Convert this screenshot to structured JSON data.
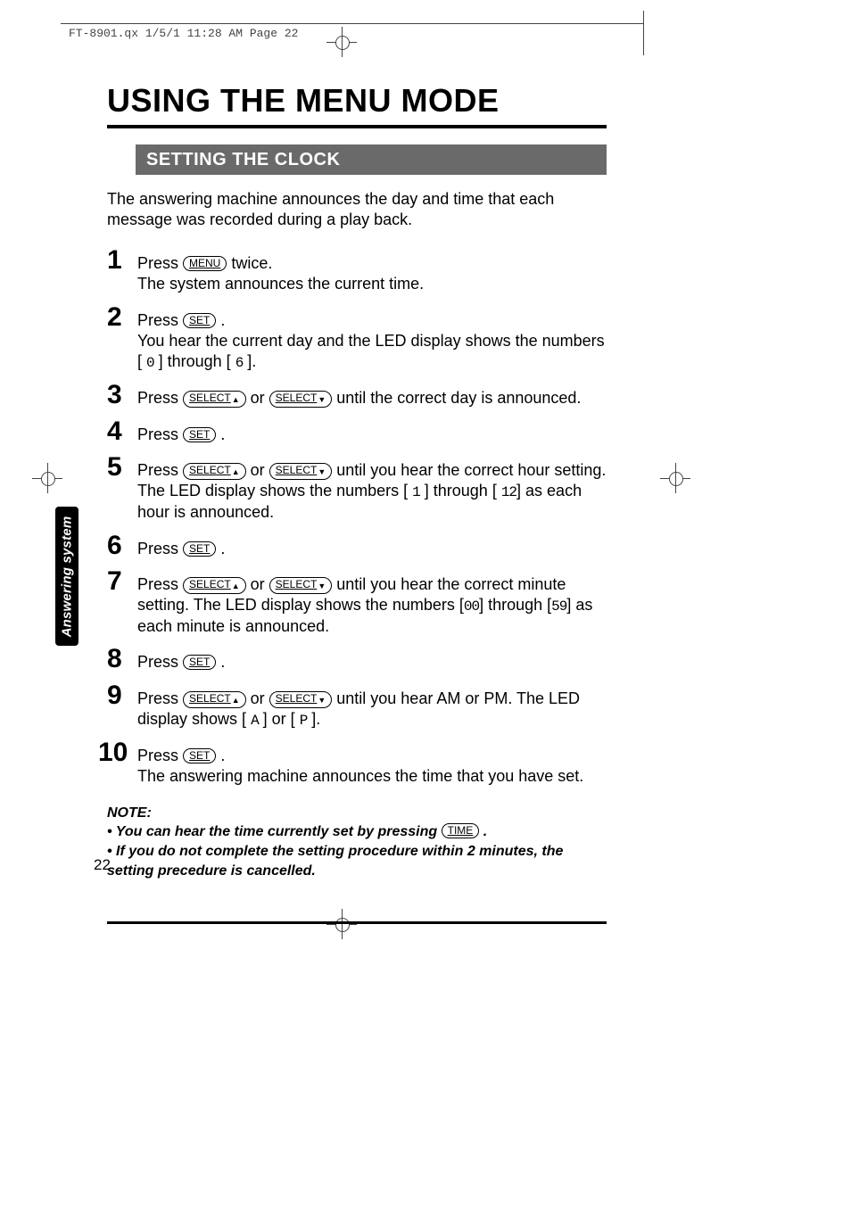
{
  "slug": "FT-8901.qx  1/5/1 11:28 AM  Page 22",
  "title": "USING THE MENU MODE",
  "section": "SETTING THE CLOCK",
  "intro": "The answering machine announces the day and time that each message was recorded during a play back.",
  "buttons": {
    "menu": "MENU",
    "set": "SET",
    "select_up": "SELECT",
    "select_down": "SELECT",
    "time": "TIME"
  },
  "steps": {
    "s1": {
      "n": "1",
      "a": "Press ",
      "b": " twice.",
      "c": "The system announces the current time."
    },
    "s2": {
      "n": "2",
      "a": "Press ",
      "b": " .",
      "c1": "You hear the current day and the LED display shows the numbers [ ",
      "seg1": "0",
      "c2": " ] through [ ",
      "seg2": "6",
      "c3": " ]."
    },
    "s3": {
      "n": "3",
      "a": "Press ",
      "b": " or ",
      "c": " until the correct day is announced."
    },
    "s4": {
      "n": "4",
      "a": "Press ",
      "b": " ."
    },
    "s5": {
      "n": "5",
      "a": "Press ",
      "b": " or ",
      "c": " until you hear the correct hour setting. The LED display shows the numbers [ ",
      "seg1": "1",
      "c2": " ] through [ ",
      "seg2": "12",
      "c3": "] as each hour is announced."
    },
    "s6": {
      "n": "6",
      "a": "Press ",
      "b": " ."
    },
    "s7": {
      "n": "7",
      "a": "Press ",
      "b": " or ",
      "c": " until you hear the correct minute setting. The LED display shows the numbers [",
      "seg1": "00",
      "c2": "] through [",
      "seg2": "59",
      "c3": "] as each minute is announced."
    },
    "s8": {
      "n": "8",
      "a": "Press ",
      "b": " ."
    },
    "s9": {
      "n": "9",
      "a": "Press ",
      "b": " or ",
      "c": " until you hear AM or PM. The LED display shows [ ",
      "seg1": "A",
      "c2": " ] or [ ",
      "seg2": "P",
      "c3": " ]."
    },
    "s10": {
      "n": "10",
      "a": "Press ",
      "b": " .",
      "c": "The answering machine announces the time that you have set."
    }
  },
  "note": {
    "heading": "NOTE:",
    "b1a": "• You can hear the time currently set by pressing ",
    "b1b": " .",
    "b2": "• If you do not complete the setting procedure within 2 minutes, the setting precedure is cancelled."
  },
  "side_tab": "Answering system",
  "page_number": "22"
}
